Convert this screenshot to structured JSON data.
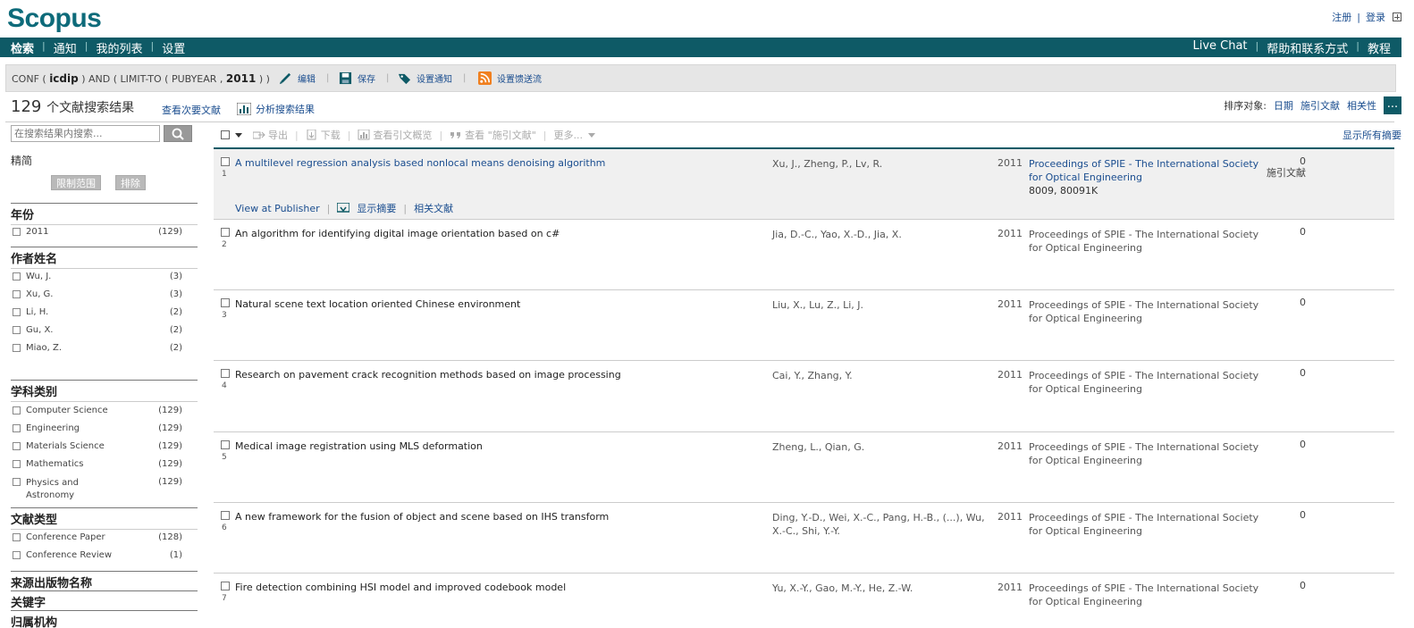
{
  "brand": {
    "logo": "Scopus"
  },
  "top_links": {
    "register": "注册",
    "login": "登录"
  },
  "nav": {
    "left": [
      "检索",
      "通知",
      "我的列表",
      "设置"
    ],
    "right": [
      "Live Chat",
      "帮助和联系方式",
      "教程"
    ]
  },
  "query": {
    "prefix": "CONF ( ",
    "term": "icdip",
    "mid": " ) AND ( LIMIT-TO ( PUBYEAR , ",
    "year": "2011",
    "suffix": " ) )",
    "actions": {
      "edit": "编辑",
      "save": "保存",
      "alert": "设置通知",
      "feed": "设置馈送流"
    }
  },
  "results_header": {
    "count": "129",
    "count_label": "个文献搜索结果",
    "view_secondary": "查看次要文献",
    "analyze": "分析搜索结果",
    "sort_label": "排序对象:",
    "sort_options": [
      "日期",
      "施引文献",
      "相关性"
    ],
    "more": "..."
  },
  "sidebar": {
    "search_placeholder": "在搜索结果内搜索...",
    "refine_title": "精简",
    "limit_btn": "限制范围",
    "exclude_btn": "排除",
    "sections": {
      "year": {
        "title": "年份",
        "items": [
          {
            "label": "2011",
            "count": "(129)"
          }
        ]
      },
      "author": {
        "title": "作者姓名",
        "items": [
          {
            "label": "Wu, J.",
            "count": "(3)"
          },
          {
            "label": "Xu, G.",
            "count": "(3)"
          },
          {
            "label": "Li, H.",
            "count": "(2)"
          },
          {
            "label": "Gu, X.",
            "count": "(2)"
          },
          {
            "label": "Miao, Z.",
            "count": "(2)"
          }
        ]
      },
      "subject": {
        "title": "学科类别",
        "items": [
          {
            "label": "Computer Science",
            "count": "(129)"
          },
          {
            "label": "Engineering",
            "count": "(129)"
          },
          {
            "label": "Materials Science",
            "count": "(129)"
          },
          {
            "label": "Mathematics",
            "count": "(129)"
          },
          {
            "label": "Physics and Astronomy",
            "count": "(129)"
          }
        ]
      },
      "doctype": {
        "title": "文献类型",
        "items": [
          {
            "label": "Conference Paper",
            "count": "(128)"
          },
          {
            "label": "Conference Review",
            "count": "(1)"
          }
        ]
      },
      "source": {
        "title": "来源出版物名称"
      },
      "keyword": {
        "title": "关键字"
      },
      "affiliation": {
        "title": "归属机构"
      }
    }
  },
  "toolbar": {
    "export": "导出",
    "download": "下载",
    "citation_overview": "查看引文概览",
    "view_cited": "查看 \"施引文献\"",
    "more": "更多...",
    "show_all_abstracts": "显示所有摘要"
  },
  "results": [
    {
      "num": "1",
      "title": "A multilevel regression analysis based nonlocal means denoising algorithm",
      "authors": "Xu, J., Zheng, P., Lv, R.",
      "year": "2011",
      "source": "Proceedings of SPIE - The International Society for Optical Engineering",
      "volume": "8009, 80091K",
      "cited": "0",
      "cited_label": "施引文献"
    },
    {
      "num": "2",
      "title": "An algorithm for identifying digital image orientation based on c#",
      "authors": "Jia, D.-C., Yao, X.-D., Jia, X.",
      "year": "2011",
      "source": "Proceedings of SPIE - The International Society for Optical Engineering",
      "cited": "0"
    },
    {
      "num": "3",
      "title": "Natural scene text location oriented Chinese environment",
      "authors": "Liu, X., Lu, Z., Li, J.",
      "year": "2011",
      "source": "Proceedings of SPIE - The International Society for Optical Engineering",
      "cited": "0"
    },
    {
      "num": "4",
      "title": "Research on pavement crack recognition methods based on image processing",
      "authors": "Cai, Y., Zhang, Y.",
      "year": "2011",
      "source": "Proceedings of SPIE - The International Society for Optical Engineering",
      "cited": "0"
    },
    {
      "num": "5",
      "title": "Medical image registration using MLS deformation",
      "authors": "Zheng, L., Qian, G.",
      "year": "2011",
      "source": "Proceedings of SPIE - The International Society for Optical Engineering",
      "cited": "0"
    },
    {
      "num": "6",
      "title": "A new framework for the fusion of object and scene based on IHS transform",
      "authors": "Ding, Y.-D., Wei, X.-C., Pang, H.-B., (...), Wu, X.-C., Shi, Y.-Y.",
      "year": "2011",
      "source": "Proceedings of SPIE - The International Society for Optical Engineering",
      "cited": "0"
    },
    {
      "num": "7",
      "title": "Fire detection combining HSI model and improved codebook model",
      "authors": "Yu, X.-Y., Gao, M.-Y., He, Z.-W.",
      "year": "2011",
      "source": "Proceedings of SPIE - The International Society for Optical Engineering",
      "cited": "0"
    }
  ],
  "first_result_actions": {
    "view_publisher": "View at Publisher",
    "show_abstract": "显示摘要",
    "related": "相关文献"
  },
  "colors": {
    "brand": "#0e6b7a",
    "nav_bg": "#0e5a66",
    "link": "#1a4d8f"
  }
}
